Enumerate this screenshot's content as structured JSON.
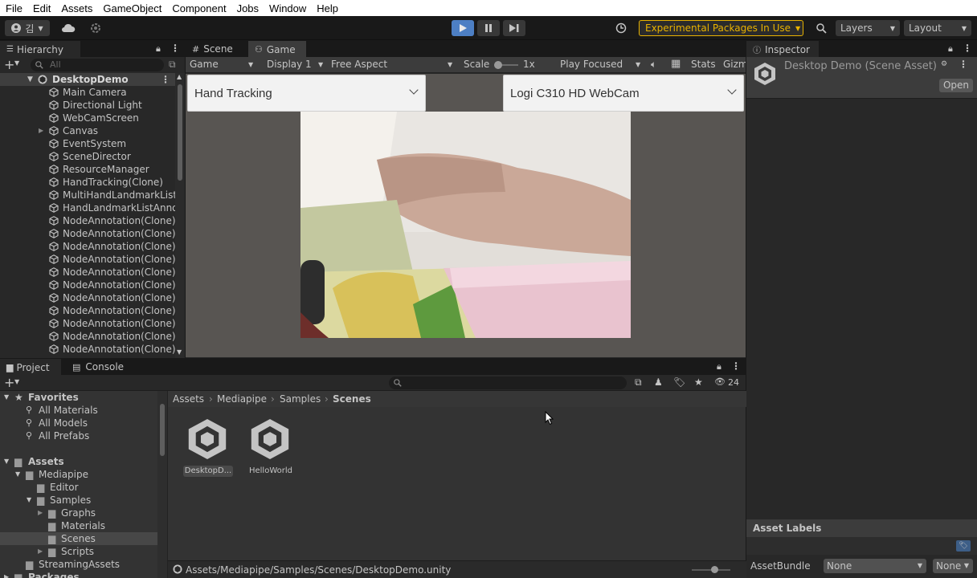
{
  "menu": [
    "File",
    "Edit",
    "Assets",
    "GameObject",
    "Component",
    "Jobs",
    "Window",
    "Help"
  ],
  "toolbar": {
    "account_label": "김",
    "experimental": "Experimental Packages In Use",
    "layers": "Layers",
    "layout": "Layout"
  },
  "hierarchy": {
    "tab": "Hierarchy",
    "search_placeholder": "All",
    "scene": "DesktopDemo",
    "items": [
      "Main Camera",
      "Directional Light",
      "WebCamScreen",
      "Canvas",
      "EventSystem",
      "SceneDirector",
      "ResourceManager",
      "HandTracking(Clone)",
      "MultiHandLandmarkList",
      "HandLandmarkListAnno",
      "NodeAnnotation(Clone)",
      "NodeAnnotation(Clone)",
      "NodeAnnotation(Clone)",
      "NodeAnnotation(Clone)",
      "NodeAnnotation(Clone)",
      "NodeAnnotation(Clone)",
      "NodeAnnotation(Clone)",
      "NodeAnnotation(Clone)",
      "NodeAnnotation(Clone)",
      "NodeAnnotation(Clone)",
      "NodeAnnotation(Clone)"
    ]
  },
  "game": {
    "tab_scene": "Scene",
    "tab_game": "Game",
    "mode": "Game",
    "display": "Display 1",
    "aspect": "Free Aspect",
    "scale_label": "Scale",
    "scale_value": "1x",
    "play_focused": "Play Focused",
    "stats": "Stats",
    "gizmos": "Gizmos",
    "solution_dropdown": "Hand Tracking",
    "camera_dropdown": "Logi C310 HD WebCam"
  },
  "inspector": {
    "tab": "Inspector",
    "title": "Desktop Demo (Scene Asset)",
    "open": "Open",
    "asset_labels": "Asset Labels",
    "assetbundle_label": "AssetBundle",
    "assetbundle_value": "None",
    "variant_value": "None"
  },
  "project": {
    "tab_project": "Project",
    "tab_console": "Console",
    "hidden_count": "24",
    "favorites": "Favorites",
    "fav_items": [
      "All Materials",
      "All Models",
      "All Prefabs"
    ],
    "assets": "Assets",
    "mediapipe": "Mediapipe",
    "editor": "Editor",
    "samples": "Samples",
    "graphs": "Graphs",
    "materials": "Materials",
    "scenes": "Scenes",
    "scripts": "Scripts",
    "streaming": "StreamingAssets",
    "packages": "Packages",
    "breadcrumb": [
      "Assets",
      "Mediapipe",
      "Samples",
      "Scenes"
    ],
    "files": [
      "DesktopD...",
      "HelloWorld"
    ],
    "status_path": "Assets/Mediapipe/Samples/Scenes/DesktopDemo.unity"
  }
}
